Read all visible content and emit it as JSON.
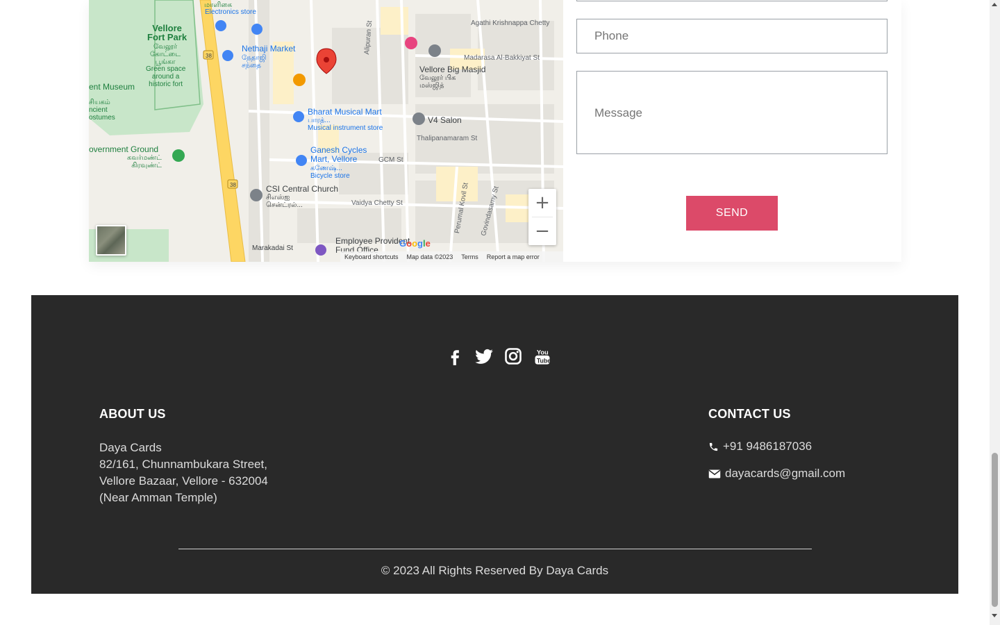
{
  "map": {
    "labels": {
      "electronics_ta": "மாளிகை",
      "electronics": "Electronics store",
      "fort_park": "Vellore\nFort Park",
      "fort_park_ta": "வேலூர்\nகோட்டை\nபூங்கா",
      "fort_park_desc": "Green space\naround a\nhistoric fort",
      "museum": "ent Museum",
      "museum_ta": "சியகம்\nncient\nostumes",
      "nethaji": "Nethaji Market",
      "nethaji_ta": "நேதாஜி\nசந்தை",
      "agathi": "Agathi Krishnappa Chetty",
      "madarasa": "Madarasa Al-Bakkiyat St",
      "big_masjid": "Vellore Big Masjid",
      "big_masjid_ta": "வேலூர் பிக\nமஸ்ஜித்",
      "alipuran": "Alipuran St",
      "bharat": "Bharat Musical Mart",
      "bharat_ta": "பாரத்...",
      "bharat_desc": "Musical instrument store",
      "v4": "V4 Salon",
      "thalipanam": "Thalipanamaram St",
      "gov_ground": "overnment Ground",
      "gov_ground_ta": "கவர்மண்ட்\nகிரவுண்ட்",
      "ganesh": "Ganesh Cycles\nMart, Vellore",
      "ganesh_ta": "கணேஷ்...",
      "ganesh_desc": "Bicycle store",
      "gcm": "GCM St",
      "csi": "CSI Central Church",
      "csi_ta": "சிஎஸ்ஐ\nசென்ட்ரல்...",
      "vaidya": "Vaidya Chetty St",
      "perumal": "Perumal Kovil St",
      "govindasamy": "Govindasamy St",
      "marakadai": "Marakadai St",
      "employee": "Employee Provident\nFund Office",
      "road_38": "38"
    },
    "footer": {
      "shortcuts": "Keyboard shortcuts",
      "map_data": "Map data ©2023",
      "terms": "Terms",
      "report": "Report a map error"
    },
    "google": "Google",
    "zoom_in": "+",
    "zoom_out": "−",
    "colors": {
      "pin": "#d93025",
      "park": "#c8e6c9",
      "road": "#fdd663",
      "poi_blue": "#4285f4"
    }
  },
  "form": {
    "phone_placeholder": "Phone",
    "message_placeholder": "Message",
    "send_label": "SEND",
    "send_color": "#dc4a69"
  },
  "footer": {
    "social": [
      {
        "icon": "facebook-icon"
      },
      {
        "icon": "twitter-icon"
      },
      {
        "icon": "instagram-icon"
      },
      {
        "icon": "youtube-icon"
      }
    ],
    "about": {
      "heading": "ABOUT US",
      "lines": [
        "Daya Cards",
        "82/161, Chunnambukara Street,",
        "Vellore Bazaar, Vellore - 632004",
        "(Near Amman Temple)"
      ]
    },
    "contact": {
      "heading": "CONTACT US",
      "phone": "+91 9486187036",
      "email": "dayacards@gmail.com"
    },
    "copyright": "© 2023 All Rights Reserved By Daya Cards",
    "background": "#292929"
  }
}
